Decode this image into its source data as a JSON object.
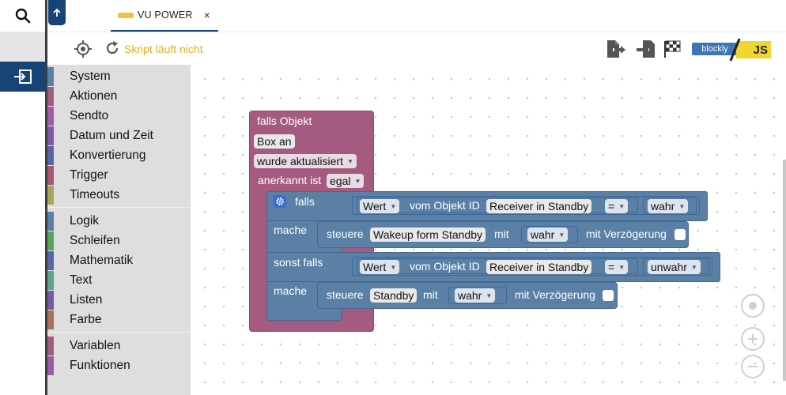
{
  "tab": {
    "title": "VU POWER",
    "close": "×"
  },
  "toolbar": {
    "status": "Skript läuft nicht",
    "mode_toggle": {
      "blockly": "blockly",
      "js": "JS"
    }
  },
  "categories": {
    "group1": [
      {
        "label": "System",
        "color": "#5b80a5"
      },
      {
        "label": "Aktionen",
        "color": "#a55b80"
      },
      {
        "label": "Sendto",
        "color": "#a55ba5"
      },
      {
        "label": "Datum und Zeit",
        "color": "#805ba5"
      },
      {
        "label": "Konvertierung",
        "color": "#5b67a5"
      },
      {
        "label": "Trigger",
        "color": "#a5596f"
      },
      {
        "label": "Timeouts",
        "color": "#a5a55b"
      }
    ],
    "group2": [
      {
        "label": "Logik",
        "color": "#5b80a5"
      },
      {
        "label": "Schleifen",
        "color": "#5ba55b"
      },
      {
        "label": "Mathematik",
        "color": "#5b67a5"
      },
      {
        "label": "Text",
        "color": "#5ba58c"
      },
      {
        "label": "Listen",
        "color": "#745ba5"
      },
      {
        "label": "Farbe",
        "color": "#a5745b"
      }
    ],
    "group3": [
      {
        "label": "Variablen",
        "color": "#a55b80"
      },
      {
        "label": "Funktionen",
        "color": "#995ba5"
      }
    ]
  },
  "blocks": {
    "trigger": {
      "title": "falls Objekt",
      "object": "Box an",
      "event": "wurde aktualisiert",
      "ack_label": "anerkannt ist",
      "ack_value": "egal"
    },
    "if_block": {
      "if_label": "falls",
      "do_label": "mache",
      "elseif_label": "sonst falls",
      "do2_label": "mache"
    },
    "condition1": {
      "attr": "Wert",
      "of_label": "vom Objekt ID",
      "object": "Receiver in Standby",
      "op": "=",
      "value": "wahr"
    },
    "action1": {
      "label": "steuere",
      "target": "Wakeup form Standby",
      "with_label": "mit",
      "value": "wahr",
      "delay_label": "mit Verzögerung"
    },
    "condition2": {
      "attr": "Wert",
      "of_label": "vom Objekt ID",
      "object": "Receiver in Standby",
      "op": "=",
      "value": "unwahr"
    },
    "action2": {
      "label": "steuere",
      "target": "Standby",
      "with_label": "mit",
      "value": "wahr",
      "delay_label": "mit Verzögerung"
    }
  },
  "colors": {
    "purple_block": "#a55b80",
    "blue_block": "#5b80a5",
    "nav_blue": "#164477",
    "status_orange": "#f0ad1e"
  }
}
